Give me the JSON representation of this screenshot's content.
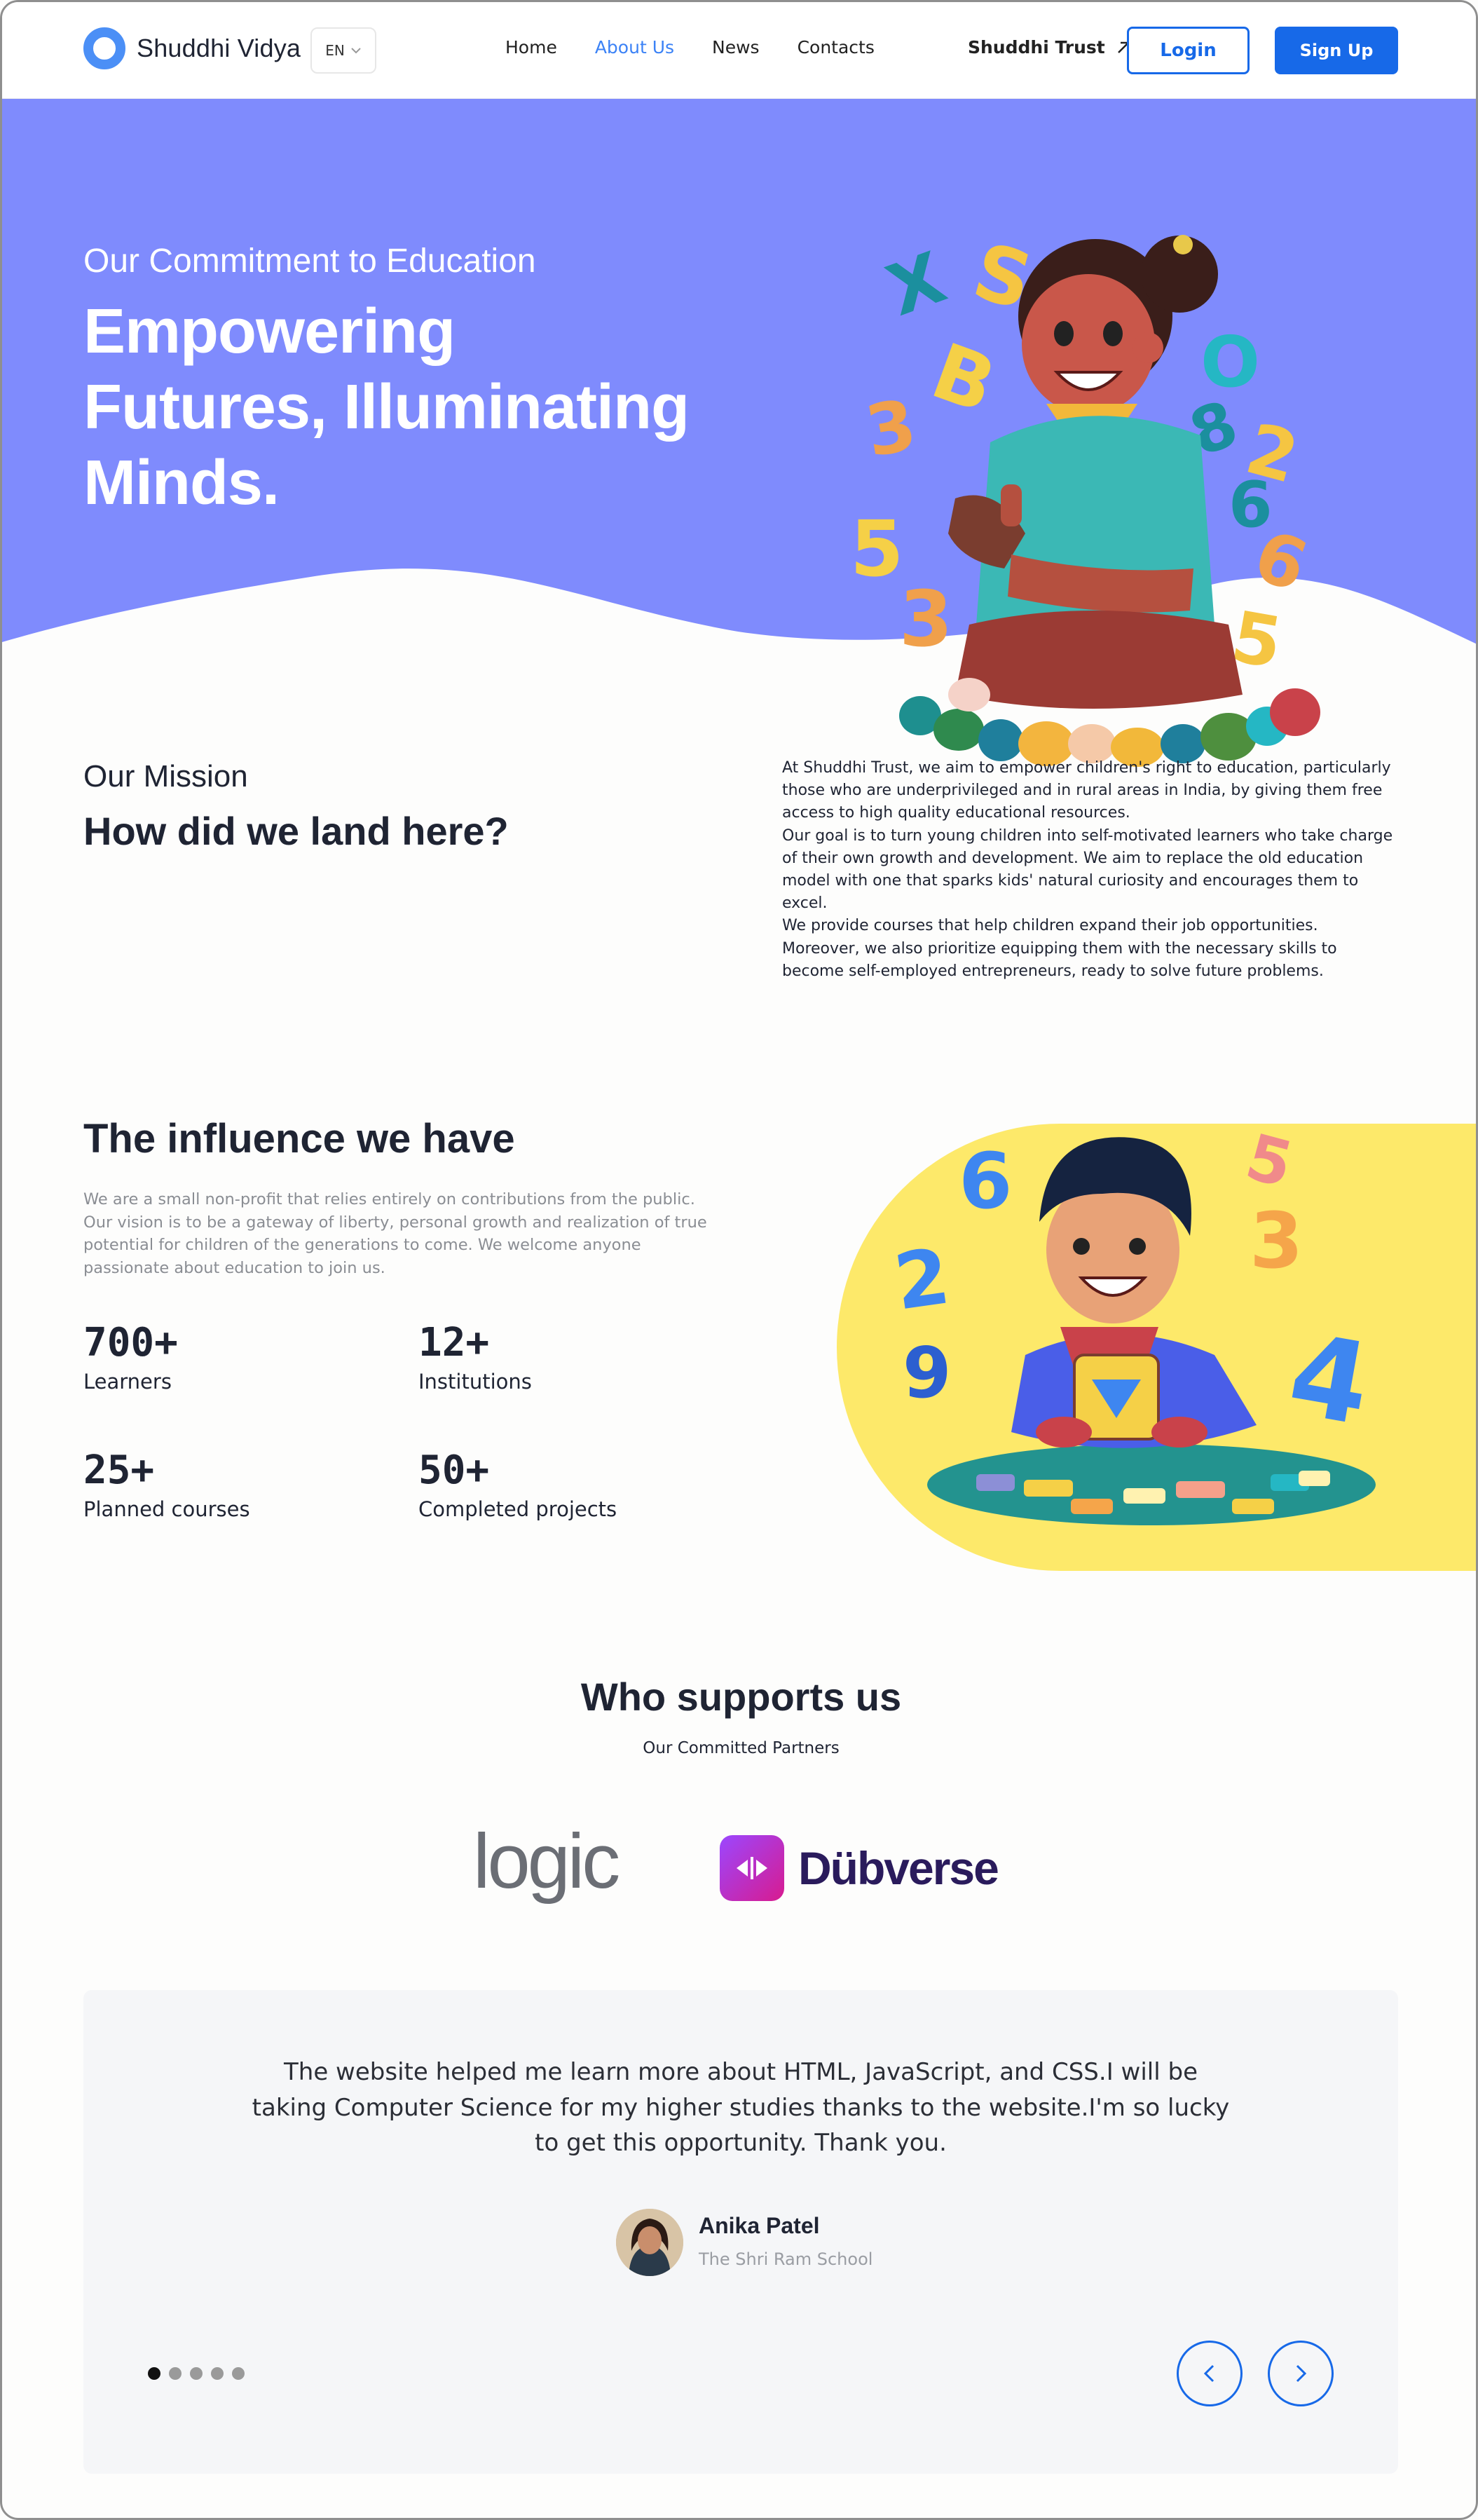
{
  "header": {
    "brand": "Shuddhi Vidya",
    "lang": "EN",
    "nav": [
      {
        "label": "Home",
        "active": false
      },
      {
        "label": "About Us",
        "active": true
      },
      {
        "label": "News",
        "active": false
      },
      {
        "label": "Contacts",
        "active": false
      }
    ],
    "trust_link": "Shuddhi Trust",
    "login": "Login",
    "signup": "Sign Up"
  },
  "hero": {
    "subtitle": "Our Commitment to Education",
    "title": "Empowering Futures, Illuminating Minds."
  },
  "mission": {
    "subtitle": "Our Mission",
    "title": "How did we land here?",
    "paragraphs": [
      "At Shuddhi Trust, we aim to empower children's right to education, particularly those who are underprivileged and in rural areas in India, by giving them free access to high quality educational resources.",
      "Our goal is to turn young children into self-motivated learners who take charge of their own growth and development. We aim to replace the old education model with one that sparks kids' natural curiosity and encourages them to excel.",
      "We provide courses that help children expand their job opportunities. Moreover, we also prioritize equipping them with the necessary skills to become self-employed entrepreneurs, ready to solve future problems."
    ]
  },
  "influence": {
    "title": "The influence we have",
    "text": "We are a small non-profit that relies entirely on contributions from the public. Our vision is to be a gateway of liberty, personal growth and realization of true potential for children of the generations to come. We welcome anyone passionate about education to join us.",
    "stats": [
      {
        "value": "700+",
        "label": "Learners"
      },
      {
        "value": "12+",
        "label": "Institutions"
      },
      {
        "value": "25+",
        "label": "Planned courses"
      },
      {
        "value": "50+",
        "label": "Completed projects"
      }
    ]
  },
  "supporters": {
    "title": "Who supports us",
    "subtitle": "Our Committed Partners",
    "partners": [
      "logic",
      "Dübverse"
    ]
  },
  "testimonial": {
    "quote": "The website helped me learn more about HTML, JavaScript, and CSS.I will be taking Computer Science for my higher studies thanks to the website.I'm so lucky to get this opportunity. Thank you.",
    "name": "Anika Patel",
    "school": "The Shri Ram School",
    "slides": 5,
    "active_slide": 1
  },
  "colors": {
    "hero_bg": "#7f8bfd",
    "accent": "#1769e8",
    "yellow_panel": "#fde96a"
  }
}
